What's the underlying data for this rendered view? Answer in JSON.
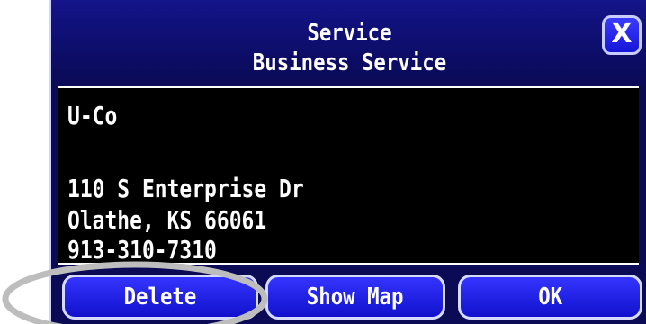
{
  "dialog": {
    "title_line1": "Service",
    "title_line2": "Business Service",
    "close_glyph": "X"
  },
  "info": {
    "name": "U-Co",
    "address_line1": "110 S Enterprise Dr",
    "address_line2": "Olathe, KS 66061",
    "phone": "913-310-7310"
  },
  "buttons": {
    "delete_label": "Delete",
    "show_map_label": "Show Map",
    "ok_label": "OK"
  },
  "colors": {
    "background": "#0a0a55",
    "button": "#1f1fe6",
    "highlight": "#bdbdbd"
  },
  "icons": {
    "close": "close-icon"
  }
}
